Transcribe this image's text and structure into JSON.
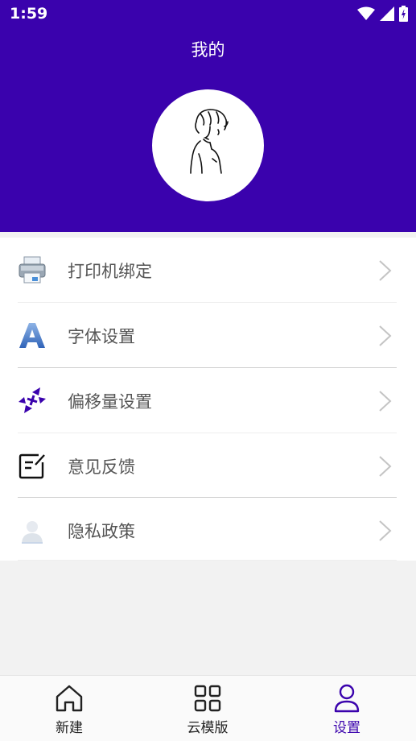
{
  "status": {
    "time": "1:59"
  },
  "header": {
    "title": "我的"
  },
  "menu": {
    "items": [
      {
        "label": "打印机绑定",
        "icon": "printer-icon"
      },
      {
        "label": "字体设置",
        "icon": "font-icon"
      },
      {
        "label": "偏移量设置",
        "icon": "offset-arrows-icon"
      },
      {
        "label": "意见反馈",
        "icon": "feedback-icon"
      },
      {
        "label": "隐私政策",
        "icon": "privacy-icon"
      }
    ]
  },
  "tabs": [
    {
      "label": "新建",
      "icon": "home-icon",
      "active": false
    },
    {
      "label": "云模版",
      "icon": "grid-icon",
      "active": false
    },
    {
      "label": "设置",
      "icon": "user-icon",
      "active": true
    }
  ],
  "colors": {
    "primary": "#3a02ad",
    "background": "#f2f2f2",
    "text": "#555555"
  }
}
